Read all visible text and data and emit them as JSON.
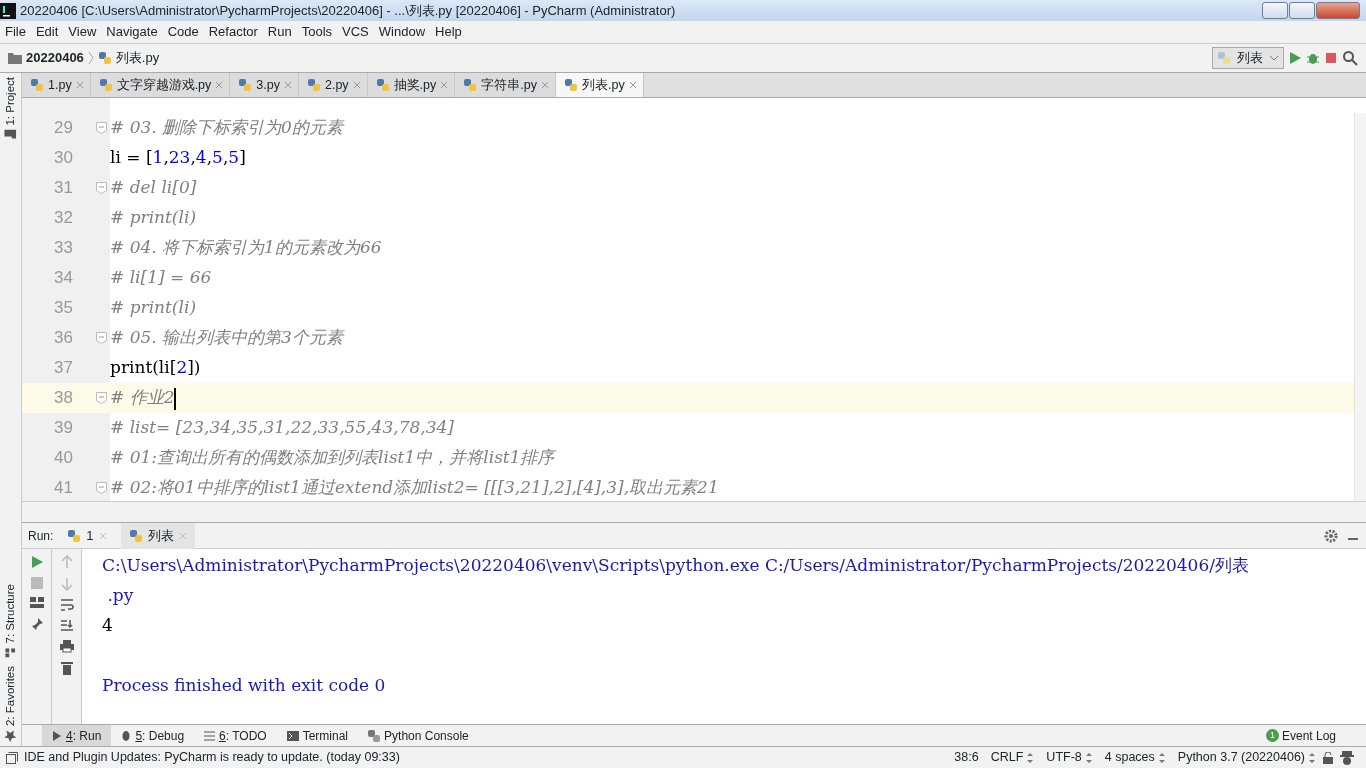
{
  "window": {
    "title": "20220406 [C:\\Users\\Administrator\\PycharmProjects\\20220406] - ...\\列表.py [20220406] - PyCharm (Administrator)"
  },
  "menu": [
    "File",
    "Edit",
    "View",
    "Navigate",
    "Code",
    "Refactor",
    "Run",
    "Tools",
    "VCS",
    "Window",
    "Help"
  ],
  "breadcrumb": {
    "project": "20220406",
    "file": "列表.py"
  },
  "run_config": {
    "label": "列表"
  },
  "tabs": [
    {
      "label": "1.py",
      "selected": false
    },
    {
      "label": "文字穿越游戏.py",
      "selected": false
    },
    {
      "label": "3.py",
      "selected": false
    },
    {
      "label": "2.py",
      "selected": false
    },
    {
      "label": "抽奖.py",
      "selected": false
    },
    {
      "label": "字符串.py",
      "selected": false
    },
    {
      "label": "列表.py",
      "selected": true
    }
  ],
  "left_strip": {
    "top": "1: Project",
    "bottom": [
      "7: Structure",
      "2: Favorites"
    ]
  },
  "code_lines": [
    {
      "number": "29",
      "fold": true,
      "current": false,
      "segments": [
        {
          "kind": "comment",
          "text": "# 03. 删除下标索引为0的元素"
        }
      ]
    },
    {
      "number": "30",
      "fold": false,
      "current": false,
      "segments": [
        {
          "kind": "plain",
          "text": "li = ["
        },
        {
          "kind": "number",
          "text": "1"
        },
        {
          "kind": "plain",
          "text": ","
        },
        {
          "kind": "number",
          "text": "23"
        },
        {
          "kind": "plain",
          "text": ","
        },
        {
          "kind": "number",
          "text": "4"
        },
        {
          "kind": "plain",
          "text": ","
        },
        {
          "kind": "number",
          "text": "5"
        },
        {
          "kind": "plain",
          "text": ","
        },
        {
          "kind": "number",
          "text": "5"
        },
        {
          "kind": "plain",
          "text": "]"
        }
      ]
    },
    {
      "number": "31",
      "fold": true,
      "current": false,
      "segments": [
        {
          "kind": "comment",
          "text": "# del li[0]"
        }
      ]
    },
    {
      "number": "32",
      "fold": false,
      "current": false,
      "segments": [
        {
          "kind": "comment",
          "text": "# print(li)"
        }
      ]
    },
    {
      "number": "33",
      "fold": false,
      "current": false,
      "segments": [
        {
          "kind": "comment",
          "text": "# 04. 将下标索引为1的元素改为66"
        }
      ]
    },
    {
      "number": "34",
      "fold": false,
      "current": false,
      "segments": [
        {
          "kind": "comment",
          "text": "# li[1] = 66"
        }
      ]
    },
    {
      "number": "35",
      "fold": false,
      "current": false,
      "segments": [
        {
          "kind": "comment",
          "text": "# print(li)"
        }
      ]
    },
    {
      "number": "36",
      "fold": true,
      "current": false,
      "segments": [
        {
          "kind": "comment",
          "text": "# 05. 输出列表中的第3个元素"
        }
      ]
    },
    {
      "number": "37",
      "fold": false,
      "current": false,
      "segments": [
        {
          "kind": "plain",
          "text": "print(li["
        },
        {
          "kind": "number",
          "text": "2"
        },
        {
          "kind": "plain",
          "text": "])"
        }
      ]
    },
    {
      "number": "38",
      "fold": true,
      "current": true,
      "segments": [
        {
          "kind": "comment",
          "text": "# 作业2"
        }
      ]
    },
    {
      "number": "39",
      "fold": false,
      "current": false,
      "segments": [
        {
          "kind": "comment",
          "text": "# list= [23,34,35,31,22,33,55,43,78,34]"
        }
      ]
    },
    {
      "number": "40",
      "fold": false,
      "current": false,
      "segments": [
        {
          "kind": "comment",
          "text": "# 01:查询出所有的偶数添加到列表list1中，并将list1排序"
        }
      ]
    },
    {
      "number": "41",
      "fold": true,
      "current": false,
      "segments": [
        {
          "kind": "comment",
          "text": "# 02:将01中排序的list1通过extend添加list2= [[[3,21],2],[4],3],取出元素21"
        }
      ]
    }
  ],
  "run_panel": {
    "title": "Run:",
    "tabs": [
      {
        "label": "1",
        "selected": false
      },
      {
        "label": "列表",
        "selected": true
      }
    ],
    "output": [
      {
        "kind": "system",
        "text": "C:\\Users\\Administrator\\PycharmProjects\\20220406\\venv\\Scripts\\python.exe C:/Users/Administrator/PycharmProjects/20220406/列表"
      },
      {
        "kind": "system",
        "text": " .py"
      },
      {
        "kind": "stdout",
        "text": "4"
      },
      {
        "kind": "exit",
        "text": "Process finished with exit code 0"
      }
    ]
  },
  "tool_tabs": [
    {
      "key": "4",
      "label": ": Run",
      "selected": true
    },
    {
      "key": "5",
      "label": ": Debug",
      "selected": false
    },
    {
      "key": "6",
      "label": ": TODO",
      "selected": false
    },
    {
      "label": "Terminal",
      "selected": false
    },
    {
      "label": "Python Console",
      "selected": false
    }
  ],
  "event_log": {
    "count": "1",
    "label": "Event Log"
  },
  "status_bar": {
    "message": "IDE and Plugin Updates: PyCharm is ready to update. (today 09:33)",
    "position": "38:6",
    "line_ending": "CRLF",
    "encoding": "UTF-8",
    "indent": "4 spaces",
    "interpreter": "Python 3.7 (20220406)"
  }
}
